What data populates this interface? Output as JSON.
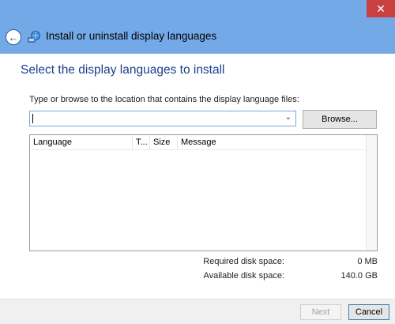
{
  "window": {
    "close_glyph": "✕",
    "title": "Install or uninstall display languages",
    "title_icon": "globe-install-icon",
    "back_glyph": "←"
  },
  "main": {
    "heading": "Select the display languages to install",
    "prompt": "Type or browse to the location that contains the display language files:",
    "path_value": "",
    "browse_label": "Browse...",
    "columns": [
      "Language",
      "T...",
      "Size",
      "Message"
    ],
    "rows": []
  },
  "disk": {
    "required_label": "Required disk space:",
    "required_value": "0 MB",
    "available_label": "Available disk space:",
    "available_value": "140.0 GB"
  },
  "footer": {
    "next_label": "Next",
    "cancel_label": "Cancel"
  },
  "colors": {
    "titlebar": "#74a9e8",
    "heading": "#1a3e8c",
    "close": "#c94040"
  }
}
